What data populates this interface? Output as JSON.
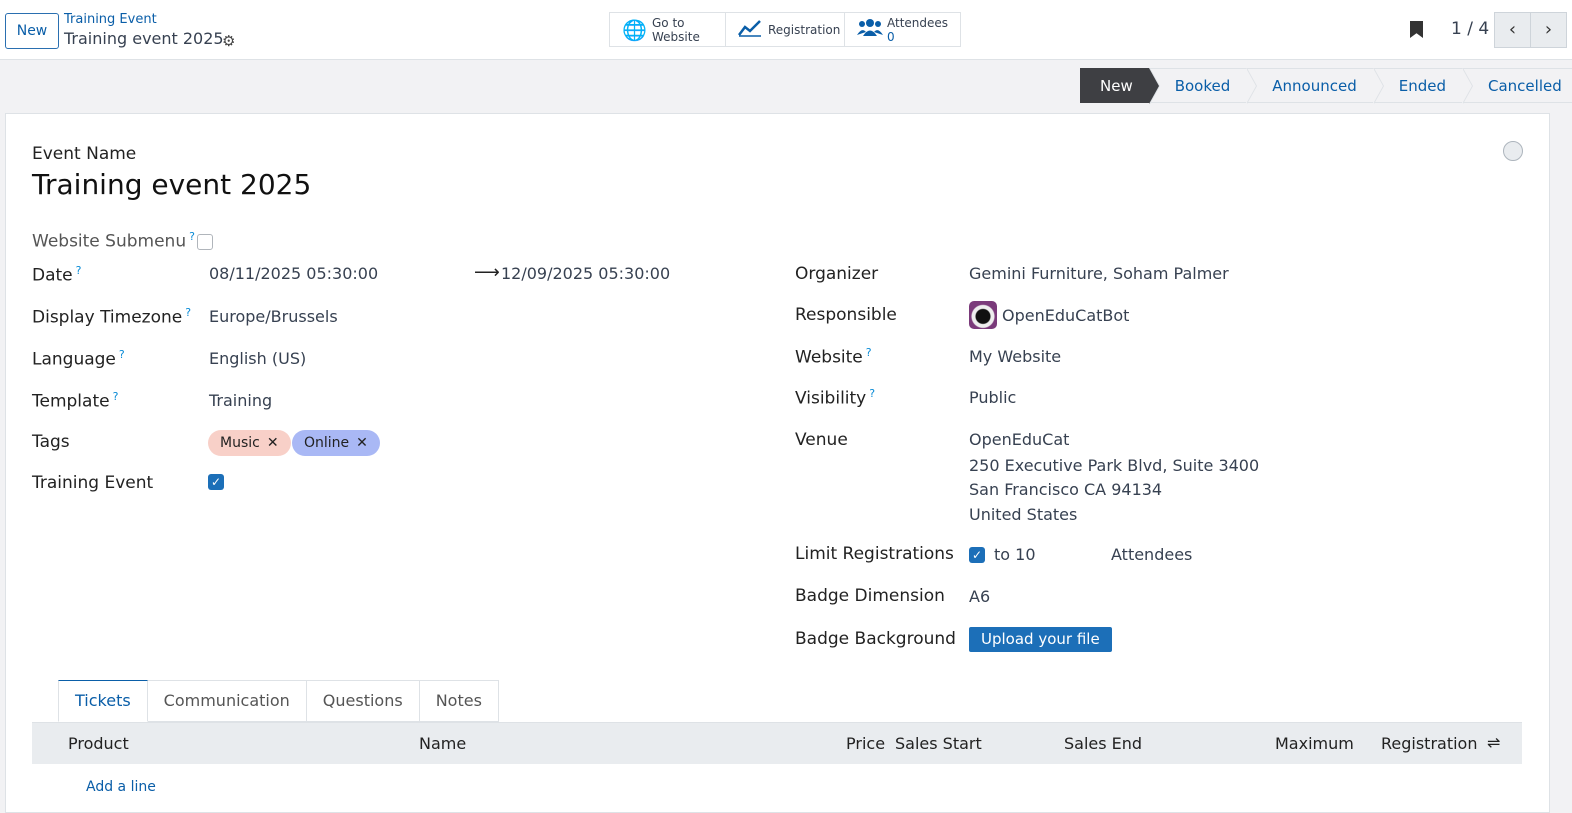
{
  "topbar": {
    "new_label": "New",
    "breadcrumb_parent": "Training Event",
    "breadcrumb_current": "Training event 2025",
    "smart_buttons": [
      {
        "line1": "Go to",
        "line2": "Website",
        "icon": "globe-icon"
      },
      {
        "line1": "Registration",
        "icon": "chart-icon"
      },
      {
        "line1": "Attendees",
        "count": "0",
        "icon": "users-icon"
      }
    ],
    "pager": "1 / 4"
  },
  "status_stages": [
    "New",
    "Booked",
    "Announced",
    "Ended",
    "Cancelled"
  ],
  "active_stage": "New",
  "form": {
    "event_name_label": "Event Name",
    "event_name": "Training event 2025",
    "website_submenu_label": "Website Submenu",
    "help": "?",
    "date_label": "Date",
    "date_start": "08/11/2025 05:30:00",
    "date_arrow": "⟶",
    "date_end": "12/09/2025 05:30:00",
    "timezone_label": "Display Timezone",
    "timezone": "Europe/Brussels",
    "language_label": "Language",
    "language": "English (US)",
    "template_label": "Template",
    "template": "Training",
    "tags_label": "Tags",
    "tags": [
      "Music",
      "Online"
    ],
    "training_event_label": "Training Event",
    "organizer_label": "Organizer",
    "organizer": "Gemini Furniture, Soham Palmer",
    "responsible_label": "Responsible",
    "responsible": "OpenEduCatBot",
    "website_label": "Website",
    "website": "My Website",
    "visibility_label": "Visibility",
    "visibility": "Public",
    "venue_label": "Venue",
    "venue_lines": [
      "OpenEduCat",
      "250 Executive Park Blvd, Suite 3400",
      "San Francisco CA 94134",
      "United States"
    ],
    "limit_label": "Limit Registrations",
    "limit_to": "to 10",
    "limit_unit": "Attendees",
    "badge_dim_label": "Badge Dimension",
    "badge_dim": "A6",
    "badge_bg_label": "Badge Background",
    "upload_label": "Upload your file"
  },
  "tabs": [
    "Tickets",
    "Communication",
    "Questions",
    "Notes"
  ],
  "ticket_columns": [
    "Product",
    "Name",
    "Price",
    "Sales Start",
    "Sales End",
    "Maximum",
    "Registration"
  ],
  "add_line": "Add a line",
  "colors": {
    "accent": "#0a5ea8",
    "tag_music": "#f8d0c8",
    "tag_online": "#a9b8f5",
    "stage_active": "#3e3f43"
  }
}
